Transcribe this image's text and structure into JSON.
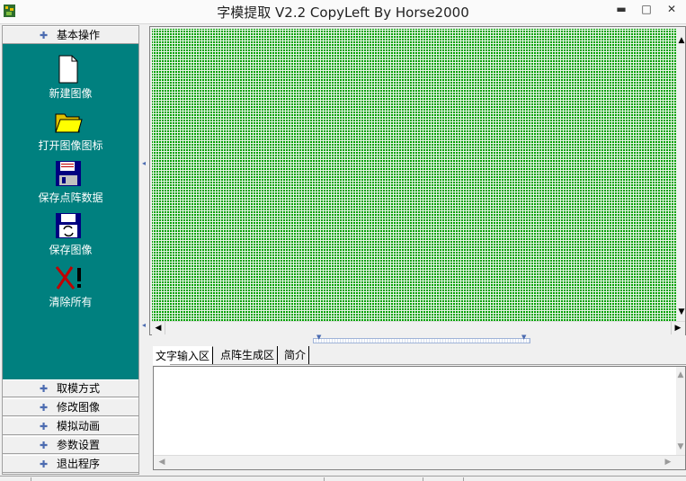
{
  "window": {
    "title": "字模提取 V2.2  CopyLeft By Horse2000",
    "buttons": {
      "minimize": "▬",
      "maximize": "□",
      "close": "✕"
    }
  },
  "sidebar": {
    "active_section": "基本操作",
    "tools": [
      {
        "label": "新建图像",
        "icon": "new-document-icon"
      },
      {
        "label": "打开图像图标",
        "icon": "open-folder-icon"
      },
      {
        "label": "保存点阵数据",
        "icon": "save-dot-matrix-icon"
      },
      {
        "label": "保存图像",
        "icon": "save-image-icon"
      },
      {
        "label": "清除所有",
        "icon": "clear-all-icon"
      }
    ],
    "sections": [
      "取模方式",
      "修改图像",
      "模拟动画",
      "参数设置",
      "退出程序"
    ]
  },
  "canvas": {
    "grid_color": "#00a000",
    "background": "#e8f5e8"
  },
  "tabs": [
    "文字输入区",
    "点阵生成区",
    "简介"
  ],
  "active_tab": "文字输入区",
  "text_input": {
    "value": ""
  },
  "colors": {
    "sidebar_bg": "#00807f",
    "accent": "#4b6bb0"
  }
}
